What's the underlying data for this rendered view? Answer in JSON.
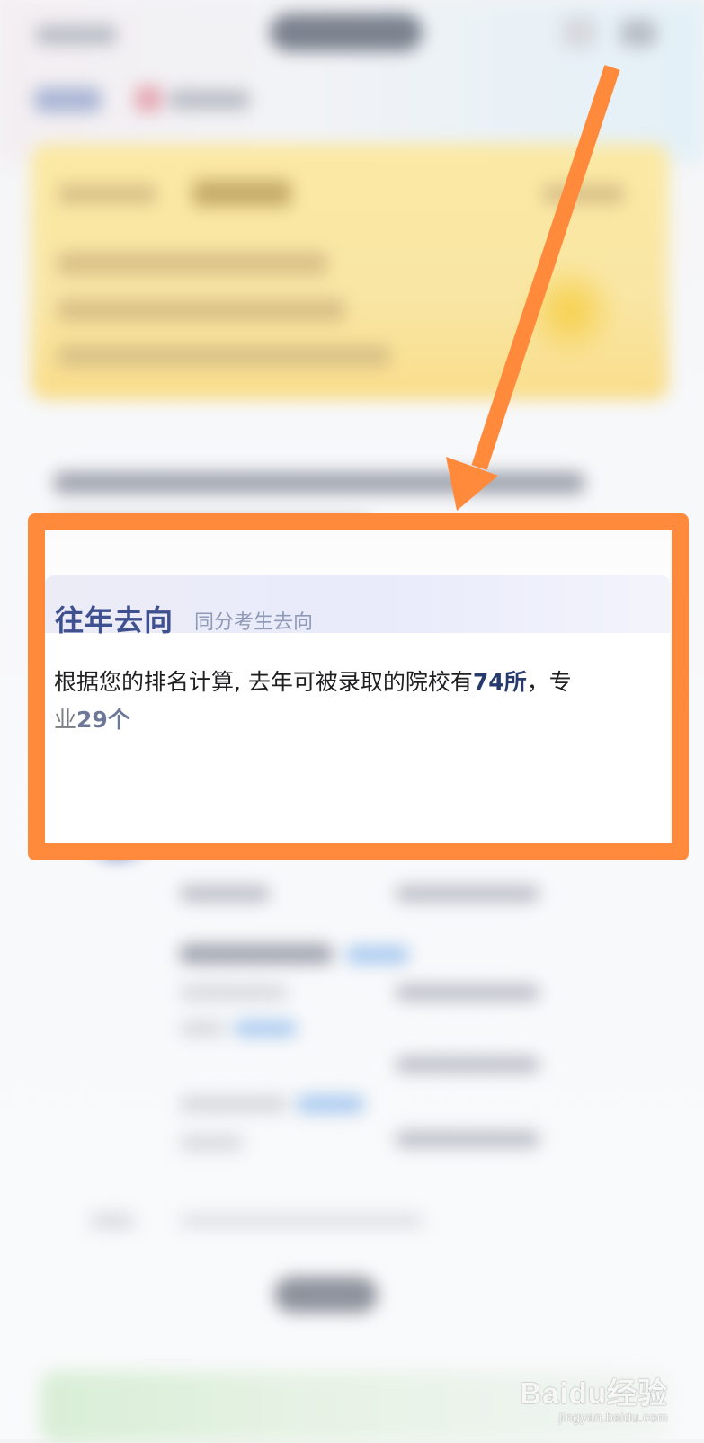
{
  "section": {
    "title": "往年去向",
    "subtitle": "同分考生去向",
    "description_before": "根据您的排名计算, 去年可被录取的院校有",
    "schools_count": "74所",
    "comma": "，专",
    "line2_prefix": "业",
    "majors_count": "29个"
  },
  "watermark": {
    "brand": "Baidu经验",
    "url": "jingyan.baidu.com"
  },
  "colors": {
    "annotation_orange": "#ff8a3c",
    "title_navy": "#3f5090",
    "count_navy": "#273a6d"
  },
  "icons": {
    "annotation_arrow": "arrow-down-left-icon",
    "avatar": "avatar-icon"
  }
}
